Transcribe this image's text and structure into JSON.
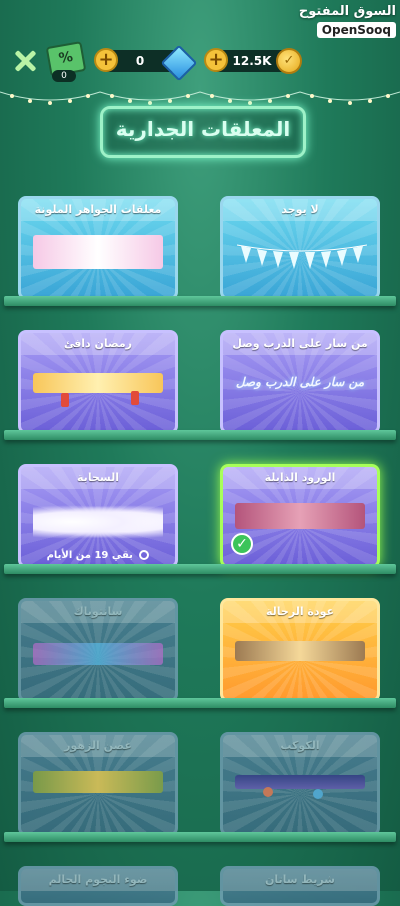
{
  "watermark": {
    "arabic": "السوق المفتوح",
    "brand": "OpenSooq"
  },
  "topbar": {
    "coupon_label": "%",
    "coupon_count": "0",
    "gems_value": "0",
    "coins_value": "12.5K",
    "colors": {
      "plus": "#f4c23a",
      "pill": "#0d2f26"
    }
  },
  "page_title": "المعلقات الجدارية",
  "cards": [
    {
      "label": "معلقات الجواهر الملونة",
      "style": "blue"
    },
    {
      "label": "لا يوجد",
      "style": "blue"
    },
    {
      "label": "رمضان دافئ",
      "style": "purple"
    },
    {
      "label": "من سار على الدرب وصل",
      "style": "purple",
      "banner_text": "من سار على الدرب وصل"
    },
    {
      "label": "السحابة",
      "style": "purple",
      "timer": "بقي 19 من الأيام"
    },
    {
      "label": "الورود الذابلة",
      "style": "purple",
      "selected": true
    },
    {
      "label": "سانتوباك",
      "style": "locked"
    },
    {
      "label": "عودة الرحالة",
      "style": "orange"
    },
    {
      "label": "غصن الزهور",
      "style": "locked"
    },
    {
      "label": "الكوكب",
      "style": "locked"
    },
    {
      "label": "ضوء النجوم الحالم",
      "style": "locked"
    },
    {
      "label": "شريط ساتان",
      "style": "locked"
    }
  ]
}
